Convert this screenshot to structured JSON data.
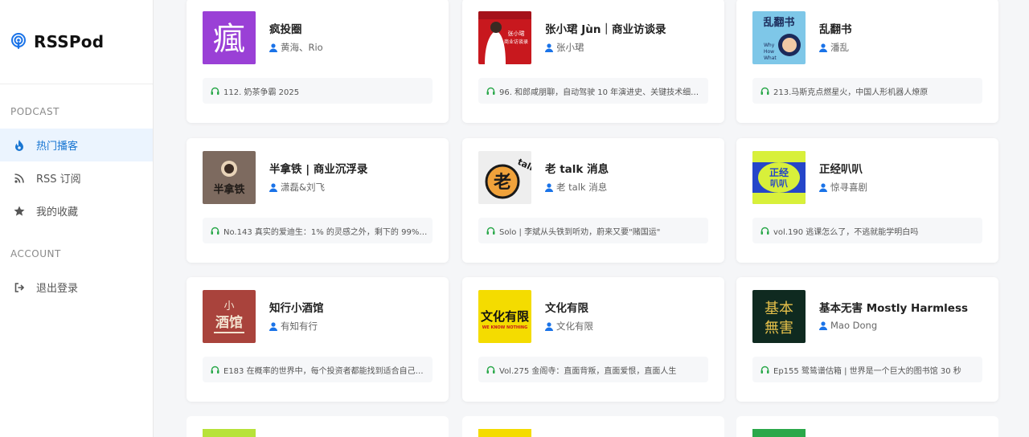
{
  "brand": {
    "name": "RSSPod",
    "icon": "podcast-icon",
    "accent": "#1a73e8"
  },
  "sidebar": {
    "podcast_section": "PODCAST",
    "account_section": "ACCOUNT",
    "items": [
      {
        "label": "热门播客",
        "icon": "flame-icon",
        "active": true
      },
      {
        "label": "RSS 订阅",
        "icon": "rss-icon",
        "active": false
      },
      {
        "label": "我的收藏",
        "icon": "star-icon",
        "active": false
      }
    ],
    "account_items": [
      {
        "label": "退出登录",
        "icon": "logout-icon"
      }
    ]
  },
  "podcasts": [
    {
      "title": "疯投圈",
      "author": "黄海、Rio",
      "episode": "112. 奶茶争霸 2025",
      "cover_color": "#8e3fd0",
      "cover_text": "瘋"
    },
    {
      "title": "张小珺 Jùn｜商业访谈录",
      "author": "张小珺",
      "episode": "96. 和郎咸朋聊，自动驾驶 10 年演进史、关键技术细节…",
      "cover_color": "#c8181e",
      "cover_text": "张小珺"
    },
    {
      "title": "乱翻书",
      "author": "潘乱",
      "episode": "213.马斯克点燃星火，中国人形机器人燎原",
      "cover_color": "#7ec7e8",
      "cover_text": "乱翻书"
    },
    {
      "title": "半拿铁 | 商业沉浮录",
      "author": "潇磊&刘飞",
      "episode": "No.143 真实的爱迪生：1% 的灵感之外，剩下的 99% …",
      "cover_color": "#7d6a5f",
      "cover_text": "半拿铁"
    },
    {
      "title": "老 talk 消息",
      "author": "老 talk 消息",
      "episode": "Solo | 李斌从头铁到听劝，蔚来又要\"赌国运\"",
      "cover_color": "#eeeeee",
      "cover_text": "老"
    },
    {
      "title": "正经叭叭",
      "author": "惊寻喜剧",
      "episode": "vol.190 逃课怎么了，不逃就能学明白吗",
      "cover_color": "#2546c9",
      "cover_text": "正经叭叭"
    },
    {
      "title": "知行小酒馆",
      "author": "有知有行",
      "episode": "E183 在概率的世界中，每个投资者都能找到适合自己的…",
      "cover_color": "#a9433c",
      "cover_text": "小酒馆"
    },
    {
      "title": "文化有限",
      "author": "文化有限",
      "episode": "Vol.275 金阁寺：直面背叛，直面爱恨，直面人生",
      "cover_color": "#f4dc00",
      "cover_text": "文化有限"
    },
    {
      "title": "基本无害 Mostly Harmless",
      "author": "Mao Dong",
      "episode": "Ep155 鹭鸶谱估箱 | 世界是一个巨大的图书馆 30 秒",
      "cover_color": "#0f2a20",
      "cover_text": "基本無害"
    }
  ],
  "peek_covers": [
    "#b7e23a",
    "#f4dc00",
    "#2aa84a"
  ]
}
